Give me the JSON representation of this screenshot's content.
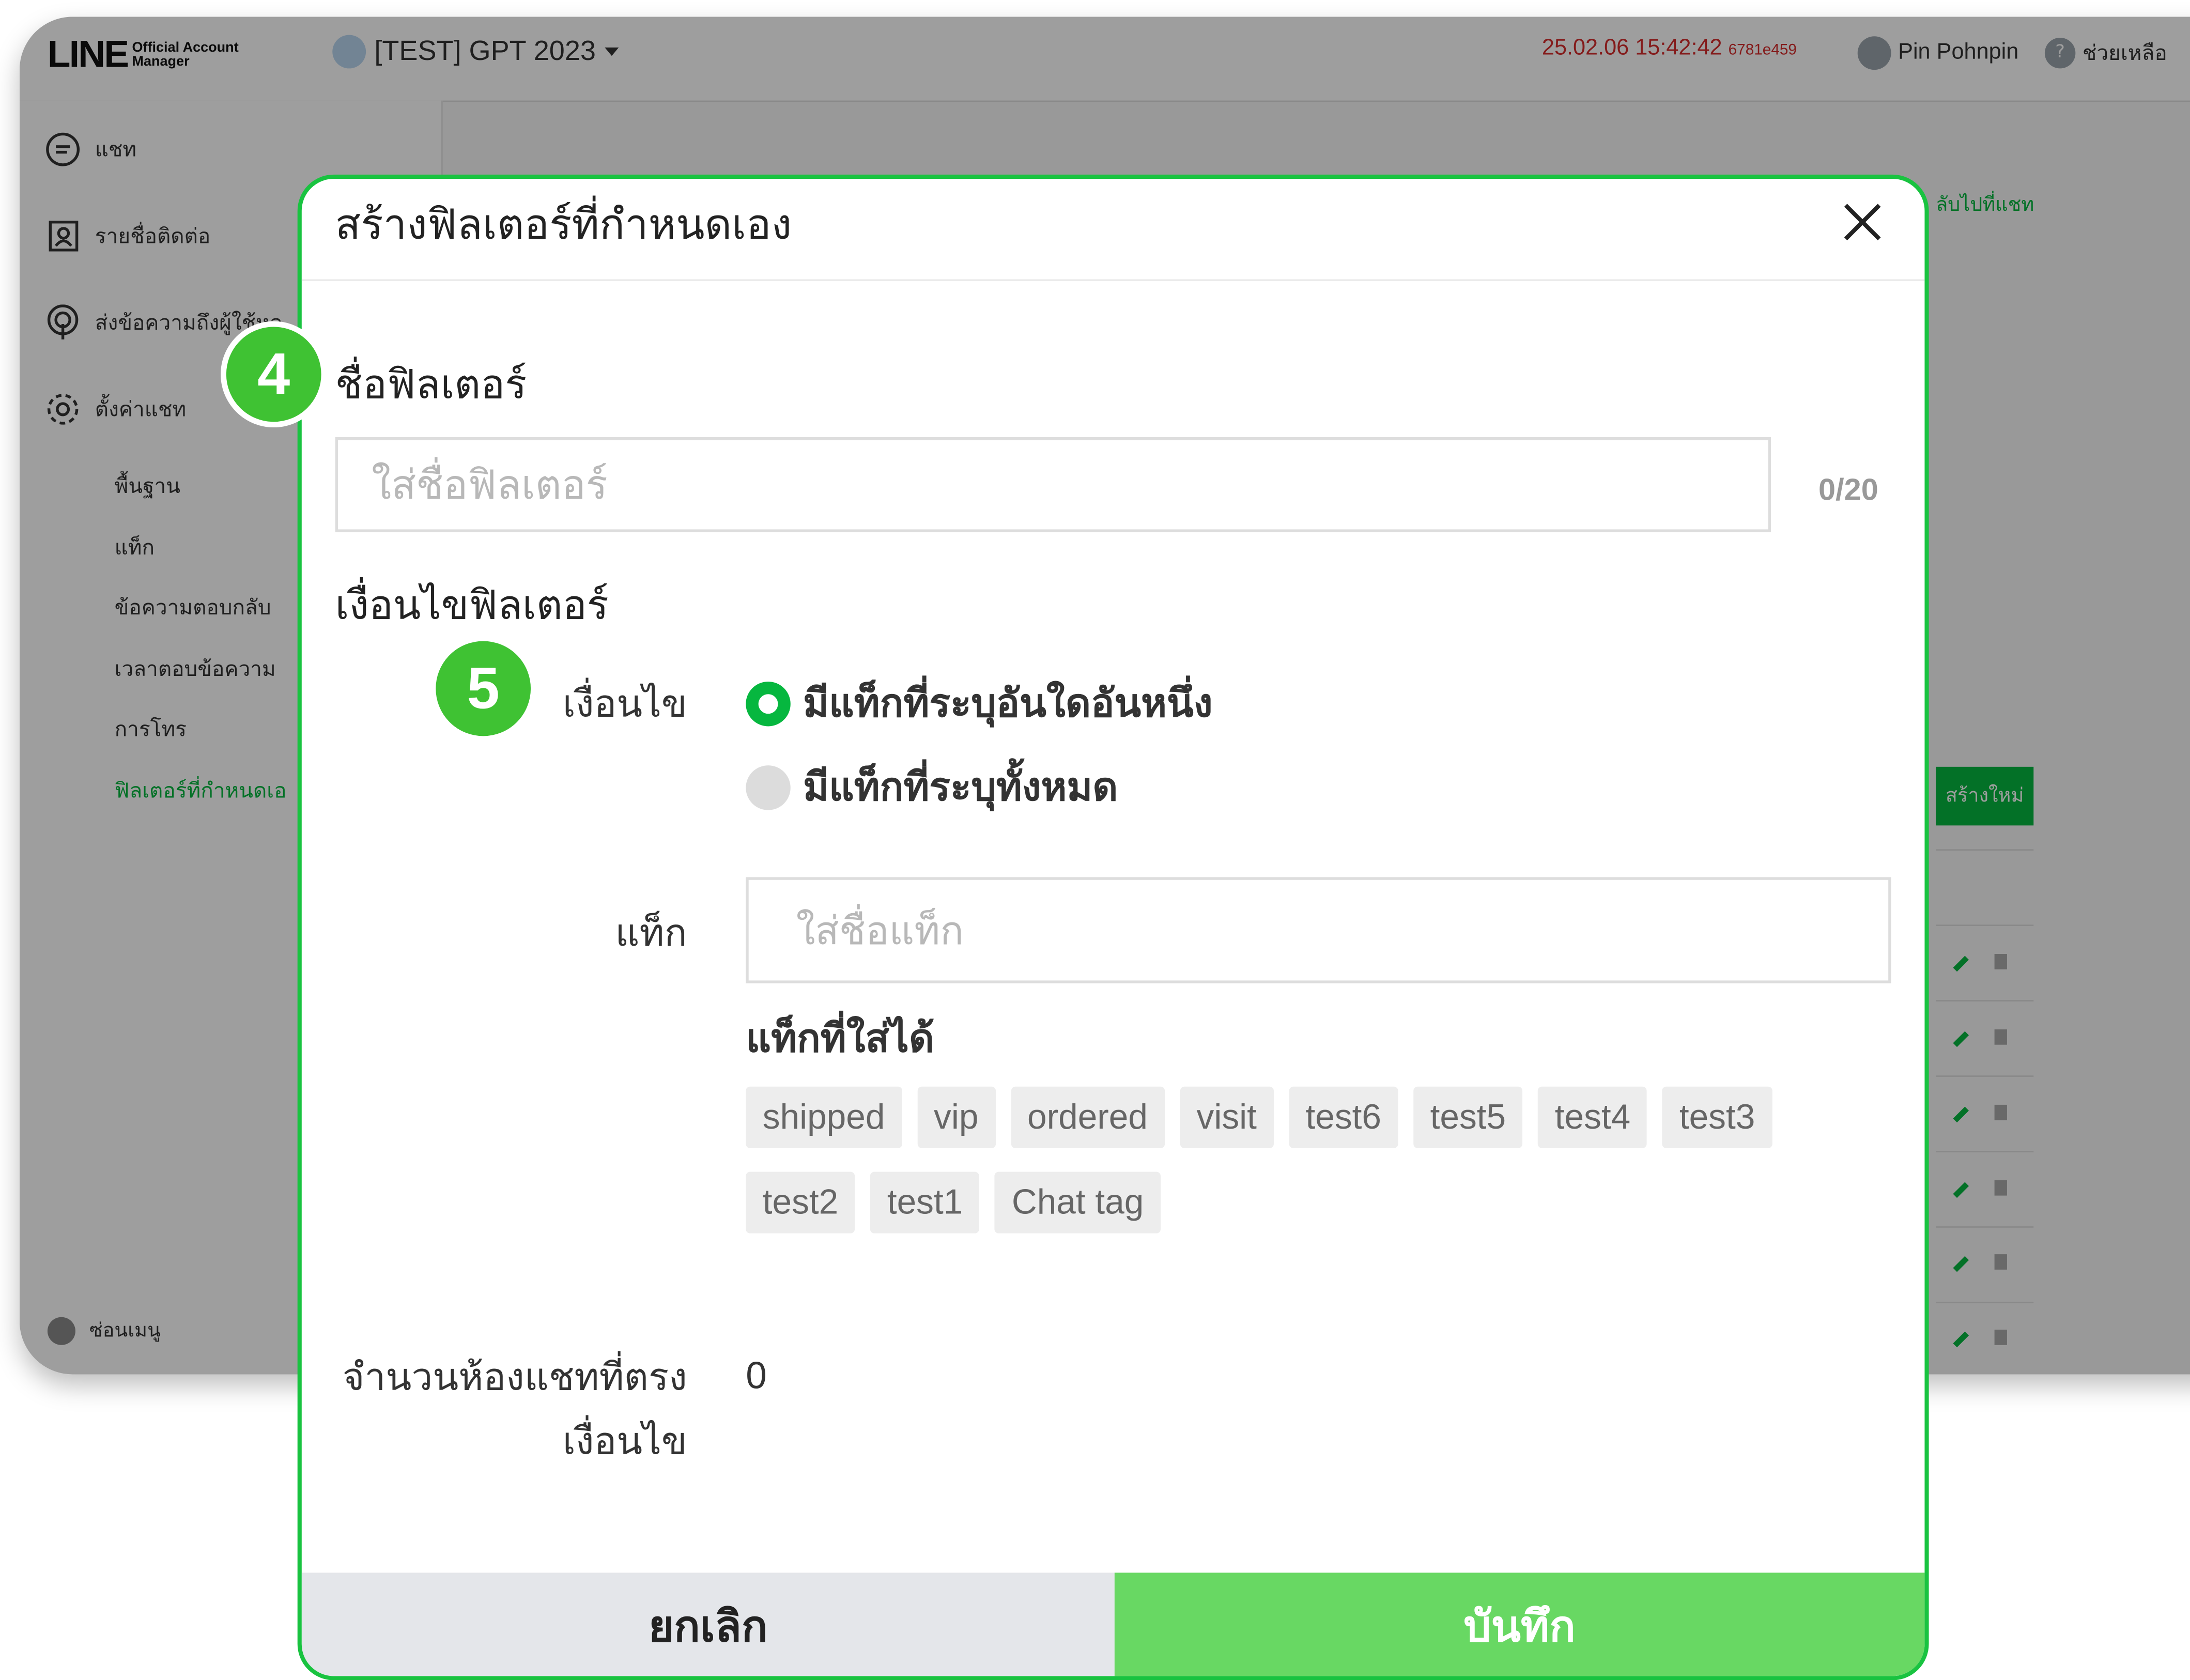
{
  "header": {
    "logo_text": "LINE",
    "logo_sub_line1": "Official Account",
    "logo_sub_line2": "Manager",
    "account_name": "[TEST] GPT 2023",
    "timestamp": "25.02.06 15:42:42",
    "build_id": "6781e459",
    "user_name": "Pin Pohnpin",
    "help_label": "ช่วยเหลือ"
  },
  "sidebar": {
    "items": [
      {
        "label": "แชท",
        "icon": "chat-icon"
      },
      {
        "label": "รายชื่อติดต่อ",
        "icon": "contacts-icon"
      },
      {
        "label": "ส่งข้อความถึงผู้ใช้หล",
        "icon": "broadcast-icon"
      },
      {
        "label": "ตั้งค่าแชท",
        "icon": "gear-icon"
      }
    ],
    "subitems": [
      {
        "label": "พื้นฐาน"
      },
      {
        "label": "แท็ก"
      },
      {
        "label": "ข้อความตอบกลับ"
      },
      {
        "label": "เวลาตอบข้อความ"
      },
      {
        "label": "การโทร"
      },
      {
        "label": "ฟิลเตอร์ที่กำหนดเอ"
      }
    ],
    "hide_menu": "ซ่อนเมนู"
  },
  "background": {
    "back_to_chat": "ลับไปที่แชท",
    "create_new": "สร้างใหม่"
  },
  "modal": {
    "title": "สร้างฟิลเตอร์ที่กำหนดเอง",
    "filter_name_label": "ชื่อฟิลเตอร์",
    "filter_name_placeholder": "ใส่ชื่อฟิลเตอร์",
    "filter_name_value": "",
    "counter": "0/20",
    "conditions_label": "เงื่อนไขฟิลเตอร์",
    "condition_label": "เงื่อนไข",
    "options": [
      {
        "label": "มีแท็กที่ระบุอันใดอันหนึ่ง",
        "selected": true
      },
      {
        "label": "มีแท็กที่ระบุทั้งหมด",
        "selected": false
      }
    ],
    "tag_label": "แท็ก",
    "tag_placeholder": "ใส่ชื่อแท็ก",
    "tag_value": "",
    "available_tags_label": "แท็กที่ใส่ได้",
    "available_tags": [
      "shipped",
      "vip",
      "ordered",
      "visit",
      "test6",
      "test5",
      "test4",
      "test3",
      "test2",
      "test1",
      "Chat tag"
    ],
    "match_count_label_line1": "จำนวนห้องแชทที่ตรง",
    "match_count_label_line2": "เงื่อนไข",
    "match_count": "0",
    "cancel_label": "ยกเลิก",
    "save_label": "บันทึก"
  },
  "steps": [
    "4",
    "5"
  ],
  "colors": {
    "brand_green": "#06b73f",
    "save_green": "#68d863",
    "highlight_border": "#19c340",
    "timestamp_red": "#d52d2d"
  }
}
